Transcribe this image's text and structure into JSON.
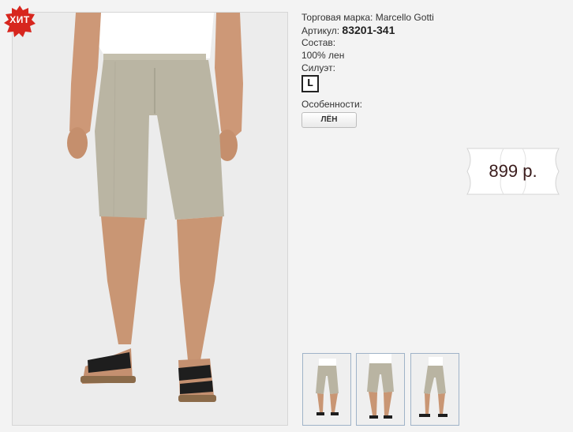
{
  "badge": {
    "label": "ХИТ",
    "color": "#d7261e"
  },
  "product": {
    "brand_label": "Торговая марка:",
    "brand_value": "Marcello Gotti",
    "sku_label": "Артикул:",
    "sku_value": "83201-341",
    "composition_label": "Состав:",
    "composition_value": "100% лен",
    "fit_label": "Силуэт:",
    "fit_value": "L",
    "features_label": "Особенности:",
    "features": [
      "ЛЁН"
    ]
  },
  "price": {
    "text": "899 р."
  },
  "thumbnails": [
    {
      "name": "front-view"
    },
    {
      "name": "front-close-view"
    },
    {
      "name": "side-view"
    }
  ],
  "colors": {
    "shorts": "#b9b4a2",
    "skin": "#c99674",
    "shirt": "#ffffff",
    "sandal": "#1e1e1e"
  }
}
